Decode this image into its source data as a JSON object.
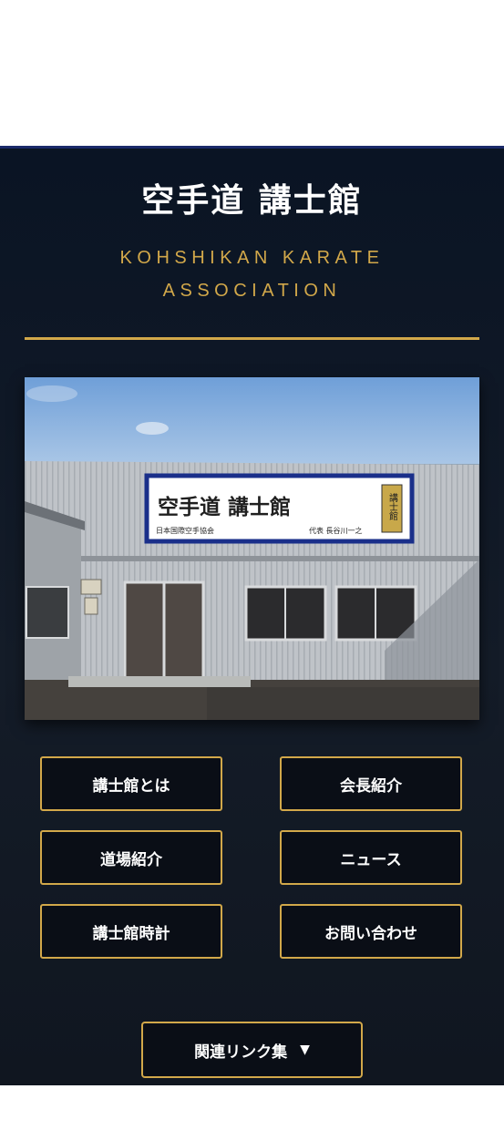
{
  "header": {
    "title": "空手道 講士館",
    "subtitle_line1": "KOHSHIKAN KARATE",
    "subtitle_line2": "ASSOCIATION"
  },
  "photo": {
    "sign_title": "空手道 講士館",
    "sign_left": "日本国際空手協会",
    "sign_right": "代表 長谷川一之",
    "sign_logo": "講士館"
  },
  "nav": {
    "about": "講士館とは",
    "president": "会長紹介",
    "dojo": "道場紹介",
    "news": "ニュース",
    "clock": "講士館時計",
    "contact": "お問い合わせ"
  },
  "links": {
    "label": "関連リンク集",
    "icon": "▼"
  },
  "colors": {
    "accent_gold": "#d2a84a",
    "panel_bg": "#0a1424"
  }
}
